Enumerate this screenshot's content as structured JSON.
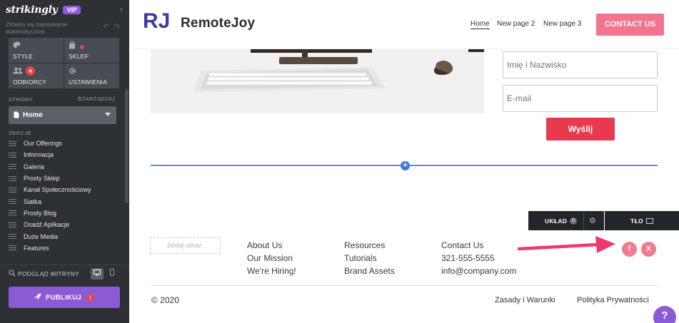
{
  "sidebar": {
    "brand": "strikingly",
    "vip_badge": "VIP",
    "save_status": "Zmiany są zapisywane automatycznie.",
    "tiles": [
      {
        "label": "STYLE",
        "icon": "palette-icon"
      },
      {
        "label": "SKLEP",
        "icon": "bag-icon"
      },
      {
        "label": "ODBIORCY",
        "icon": "people-icon",
        "badge": "4"
      },
      {
        "label": "USTAWIENIA",
        "icon": "gear-icon"
      }
    ],
    "pages_label": "STRONY",
    "manage_label": "ZARZĄDZAJ",
    "current_page": "Home",
    "sections_label": "SEKCJE",
    "sections": [
      "Our Offerings",
      "Informacja",
      "Galeria",
      "Prosty Sklep",
      "Kanał Społecznościowy",
      "Siatka",
      "Prosty Blog",
      "Osadź Aplikacje",
      "Duże Media",
      "Features"
    ],
    "preview_label": "PODGLĄD WITRYNY",
    "publish_label": "PUBLIKUJ",
    "publish_warning": "!"
  },
  "header": {
    "logo_text": "RJ",
    "site_title": "RemoteJoy",
    "nav": [
      "Home",
      "New page 2",
      "New page 3"
    ],
    "contact_label": "CONTACT US"
  },
  "form": {
    "name_placeholder": "Imię i Nazwisko",
    "email_placeholder": "E-mail",
    "send_label": "Wyślij"
  },
  "editor": {
    "add_section": "+",
    "layout_label": "UKŁAD",
    "layout_badge": "D",
    "background_label": "TŁO"
  },
  "footer": {
    "image_placeholder": "Dodaj obraz.",
    "col1": [
      "About Us",
      "Our Mission",
      "We're Hiring!"
    ],
    "col2": [
      "Resources",
      "Tutorials",
      "Brand Assets"
    ],
    "col3": [
      "Contact Us",
      "321-555-5555",
      "info@company.com"
    ],
    "social": [
      "f",
      "X"
    ],
    "copyright": "© 2020",
    "terms": "Zasady i Warunki",
    "privacy": "Polityka Prywatności"
  },
  "help_label": "?",
  "colors": {
    "sidebar_bg": "#2d3035",
    "accent_purple": "#8b5bd6",
    "contact_pink": "#f2748f",
    "send_red": "#e8394e",
    "divider_blue": "#5b8de0",
    "arrow_pink": "#f0386e"
  }
}
